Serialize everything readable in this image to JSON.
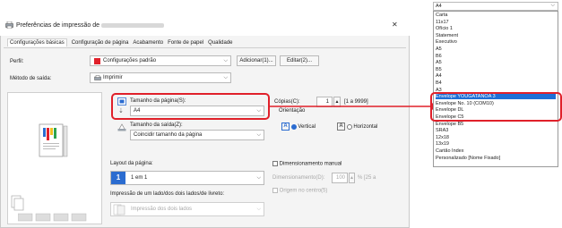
{
  "window": {
    "title": "Preferências de impressão de",
    "close_glyph": "✕"
  },
  "tabs": [
    {
      "label": "Configurações básicas"
    },
    {
      "label": "Configuração de página"
    },
    {
      "label": "Acabamento"
    },
    {
      "label": "Fonte de papel"
    },
    {
      "label": "Qualidade"
    }
  ],
  "profile": {
    "label": "Perfil:",
    "value": "Configurações padrão",
    "add_button": "Adicionar(1)...",
    "edit_button": "Editar(2)..."
  },
  "output_method": {
    "label": "Método de saída:",
    "value": "Imprimir"
  },
  "page_size": {
    "label": "Tamanho da página(S):",
    "value": "A4"
  },
  "output_size": {
    "label": "Tamanho da saída(Z):",
    "value": "Coincidir tamanho da página"
  },
  "copies": {
    "label": "Cópias(C):",
    "value": "1",
    "range": "[1 a 9999]"
  },
  "orientation": {
    "label": "Orientação",
    "vertical": "Vertical",
    "horizontal": "Horizontal",
    "icon_letter": "A"
  },
  "layout": {
    "label": "Layout da página:",
    "number": "1",
    "value": "1 em 1"
  },
  "scaling": {
    "label": "Dimensionamento manual",
    "field_label": "Dimensionamento(D):",
    "value": "100",
    "range": "% [25 a",
    "origin": "Origem no centro(5)"
  },
  "duplex": {
    "label": "Impressão de um lado/dos dois lados/de livreto:",
    "value": "Impressão dos dois lados"
  },
  "dropdown_list": {
    "selected": "A4",
    "items": [
      "Carta",
      "11x17",
      "Ofício 1",
      "Statement",
      "Executivo",
      "A5",
      "B6",
      "A5",
      "B5",
      "A4",
      "B4",
      "A3",
      "Envelope YOUGATANOA 3",
      "Envelope No. 10 (COM10)",
      "Envelope DL",
      "Envelope C5",
      "Envelope B5",
      "SRA3",
      "12x18",
      "13x19",
      "Cartão Index",
      "Personalizado [Nome Fixado]"
    ],
    "highlighted_index": 12
  },
  "colors": {
    "accent_red": "#e0202a",
    "highlight_blue": "#1e6fd6"
  }
}
